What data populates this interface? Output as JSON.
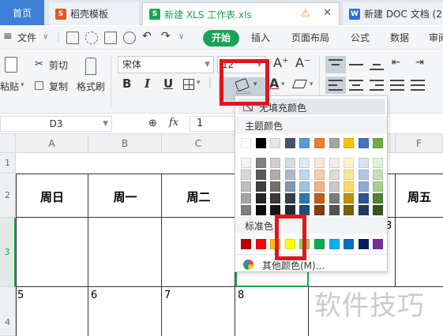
{
  "tabs": {
    "home": "首页",
    "template": "稻壳模板",
    "xls": "新建 XLS 工作表.xls",
    "doc": "新建 DOC 文档 (2"
  },
  "menu": {
    "file": "文件",
    "start": "开始",
    "insert": "插入",
    "layout": "页面布局",
    "formula": "公式",
    "data": "数据",
    "review": "审阅"
  },
  "ribbon": {
    "cut": "剪切",
    "paste": "粘贴",
    "copy": "复制",
    "format_painter": "格式刷",
    "font_name": "宋体",
    "font_size": "12",
    "grow": "A⁺",
    "shrink": "A⁻",
    "bold": "B",
    "italic": "I",
    "underline": "U",
    "fontcolor": "A"
  },
  "formula_bar": {
    "name_box": "D3",
    "fx": "fx",
    "value": "1"
  },
  "columns": [
    "A",
    "B",
    "C",
    "F"
  ],
  "rows": [
    "1",
    "2",
    "3",
    "4"
  ],
  "sheet": {
    "days": [
      "周日",
      "周一",
      "周二",
      "周五"
    ],
    "nums": [
      "5",
      "6",
      "7",
      "8"
    ],
    "partial": "3"
  },
  "fill_menu": {
    "no_fill": "无填充颜色",
    "theme_label": "主题颜色",
    "standard_label": "标准色",
    "more": "其他颜色(M)..."
  },
  "theme_top": [
    "#ffffff",
    "#000000",
    "#e7e6e6",
    "#44546a",
    "#5b9bd5",
    "#ed7d31",
    "#a5a5a5",
    "#ffc000",
    "#4472c4",
    "#70ad47"
  ],
  "theme_shades": [
    [
      "#f2f2f2",
      "#7f7f7f",
      "#d0cece",
      "#d6dce4",
      "#deebf6",
      "#fbe5d5",
      "#ededed",
      "#fff2cc",
      "#d9e2f3",
      "#e2efd9"
    ],
    [
      "#d8d8d8",
      "#595959",
      "#aeabab",
      "#adb9ca",
      "#bdd7ee",
      "#f7cbac",
      "#dbdbdb",
      "#fee599",
      "#b4c6e7",
      "#c5e0b3"
    ],
    [
      "#bfbfbf",
      "#3f3f3f",
      "#757070",
      "#8496b0",
      "#9dc3e6",
      "#f4b183",
      "#c9c9c9",
      "#ffd965",
      "#8eaadb",
      "#a8d08d"
    ],
    [
      "#a5a5a5",
      "#262626",
      "#3a3838",
      "#323f4f",
      "#2e75b5",
      "#c55a11",
      "#7b7b7b",
      "#bf9000",
      "#2f5496",
      "#538135"
    ],
    [
      "#7f7f7f",
      "#0c0c0c",
      "#171616",
      "#222a35",
      "#1e4e79",
      "#833c0b",
      "#525252",
      "#7f6000",
      "#1f3864",
      "#375623"
    ]
  ],
  "standard_colors": [
    "#c00000",
    "#ff0000",
    "#ffc000",
    "#ffff00",
    "#92d050",
    "#00b050",
    "#00b0f0",
    "#0070c0",
    "#002060",
    "#7030a0"
  ],
  "watermark": "软件技巧",
  "colors": {
    "accent": "#1aa358",
    "home_tab": "#3b7fd6",
    "highlight": "#e0161d"
  }
}
